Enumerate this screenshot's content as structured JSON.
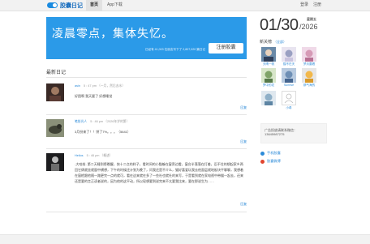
{
  "header": {
    "logo_text": "胶囊日记",
    "nav": [
      {
        "label": "首页"
      },
      {
        "label": "App下载"
      }
    ],
    "login": "登录",
    "register": "注册"
  },
  "banner": {
    "slogan": "凌晨零点，集体失忆。",
    "stats": "已经有 41,003 位朋友写下了 2,807,020 篇日记",
    "register_button": "注册胶囊",
    "color": "#2b9ae8"
  },
  "latest": {
    "title": "最新日记",
    "entries": [
      {
        "author": "asin",
        "time": "5 : 47 pm",
        "note": "（一月，然后去水）",
        "text": "好困啊 我天要了 好想睡觉",
        "reply": "回复"
      },
      {
        "author": "笔拾光人",
        "time": "5 : 46 pm",
        "note": "（2026年岁的第）",
        "text": "3月份来了！！饼了7%。。。（5641）",
        "reply": "回复"
      },
      {
        "author": "Helios",
        "time": "5 : 46 pm",
        "note": "（概述）",
        "text": "-大哈前- 第二天睡到傍晚醒，快十二点的样子，看时间的小猫躲在窗旁边看，窗台半落落在打着，忍不住的想起家乡两回它俩就坐就窗中横想，下午的时候还计划为晚了，问我还是不介么，猫好喜爱玩我去他面层就地板块平聊聊，我想着在窗檐跟他随一路更完一点的就可，看在这来就在多了一些社也就社的来写，于是看到就在家电视中带猫一起去，还来还是要的言正读者说的，因为他的这平动，所以现想要到说完来不太要我比来，要在那说生为……",
        "reply": "回复"
      }
    ]
  },
  "sidebar": {
    "date": "01/30",
    "year": "/2026",
    "weekday": "星期五",
    "friends_title": "新关榜",
    "more": "（全部）",
    "users": [
      {
        "name": "天晴一帆"
      },
      {
        "name": "猫不在天"
      },
      {
        "name": "梦月要看"
      },
      {
        "name": "梦中的花"
      },
      {
        "name": "Sunrise"
      },
      {
        "name": "那气海的"
      },
      {
        "name": ""
      },
      {
        "name": "小希"
      }
    ],
    "ad_lines": [
      "广告投放请联系微信：",
      "13645987275"
    ],
    "links": [
      {
        "label": "手机胶囊",
        "color": "#2b8ad8"
      },
      {
        "label": "胶囊微博",
        "color": "#e0452f"
      }
    ]
  }
}
